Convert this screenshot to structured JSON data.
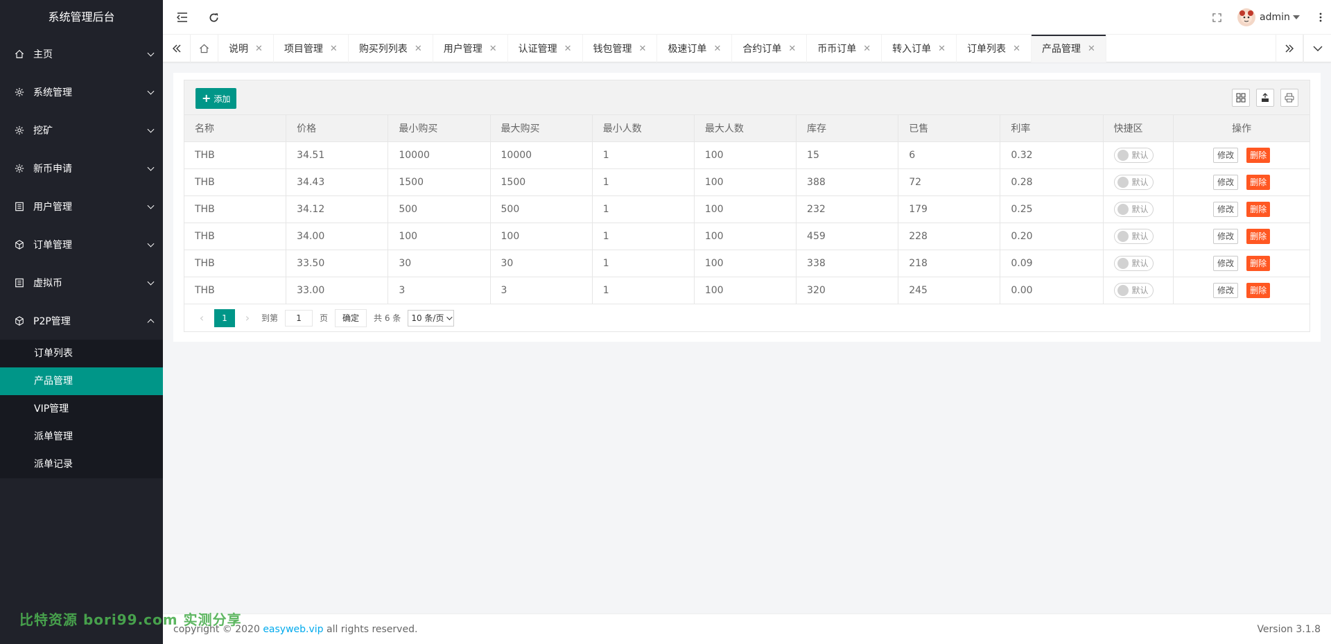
{
  "sidebar": {
    "logo": "系统管理后台",
    "menu": [
      {
        "label": "主页",
        "icon": "home-icon"
      },
      {
        "label": "系统管理",
        "icon": "gear-icon"
      },
      {
        "label": "挖矿",
        "icon": "gear-icon"
      },
      {
        "label": "新币申请",
        "icon": "gear-icon"
      },
      {
        "label": "用户管理",
        "icon": "list-icon"
      },
      {
        "label": "订单管理",
        "icon": "cube-icon"
      },
      {
        "label": "虚拟币",
        "icon": "list-icon"
      },
      {
        "label": "P2P管理",
        "icon": "cube-icon"
      }
    ],
    "submenu": [
      "订单列表",
      "产品管理",
      "VIP管理",
      "派单管理",
      "派单记录"
    ],
    "active_sub": "产品管理"
  },
  "watermark": "比特资源 bori99.com 实测分享",
  "header": {
    "user": "admin"
  },
  "tabs": [
    "说明",
    "项目管理",
    "购买列列表",
    "用户管理",
    "认证管理",
    "钱包管理",
    "极速订单",
    "合约订单",
    "币币订单",
    "转入订单",
    "订单列表",
    "产品管理"
  ],
  "active_tab": "产品管理",
  "toolbar": {
    "add_label": "添加"
  },
  "table": {
    "headers": [
      "名称",
      "价格",
      "最小购买",
      "最大购买",
      "最小人数",
      "最大人数",
      "库存",
      "已售",
      "利率",
      "快捷区",
      "操作"
    ],
    "rows": [
      [
        "THB",
        "34.51",
        "10000",
        "10000",
        "1",
        "100",
        "15",
        "6",
        "0.32"
      ],
      [
        "THB",
        "34.43",
        "1500",
        "1500",
        "1",
        "100",
        "388",
        "72",
        "0.28"
      ],
      [
        "THB",
        "34.12",
        "500",
        "500",
        "1",
        "100",
        "232",
        "179",
        "0.25"
      ],
      [
        "THB",
        "34.00",
        "100",
        "100",
        "1",
        "100",
        "459",
        "228",
        "0.20"
      ],
      [
        "THB",
        "33.50",
        "30",
        "30",
        "1",
        "100",
        "338",
        "218",
        "0.09"
      ],
      [
        "THB",
        "33.00",
        "3",
        "3",
        "1",
        "100",
        "320",
        "245",
        "0.00"
      ]
    ],
    "switch_label": "默认",
    "edit_label": "修改",
    "delete_label": "删除"
  },
  "pager": {
    "current": "1",
    "goto_label": "到第",
    "goto_value": "1",
    "page_unit": "页",
    "confirm_label": "确定",
    "total": "共 6 条",
    "page_size": "10 条/页"
  },
  "footer": {
    "prefix": "copyright © 2020 ",
    "link": "easyweb.vip",
    "suffix": " all rights reserved.",
    "version": "Version 3.1.8"
  }
}
